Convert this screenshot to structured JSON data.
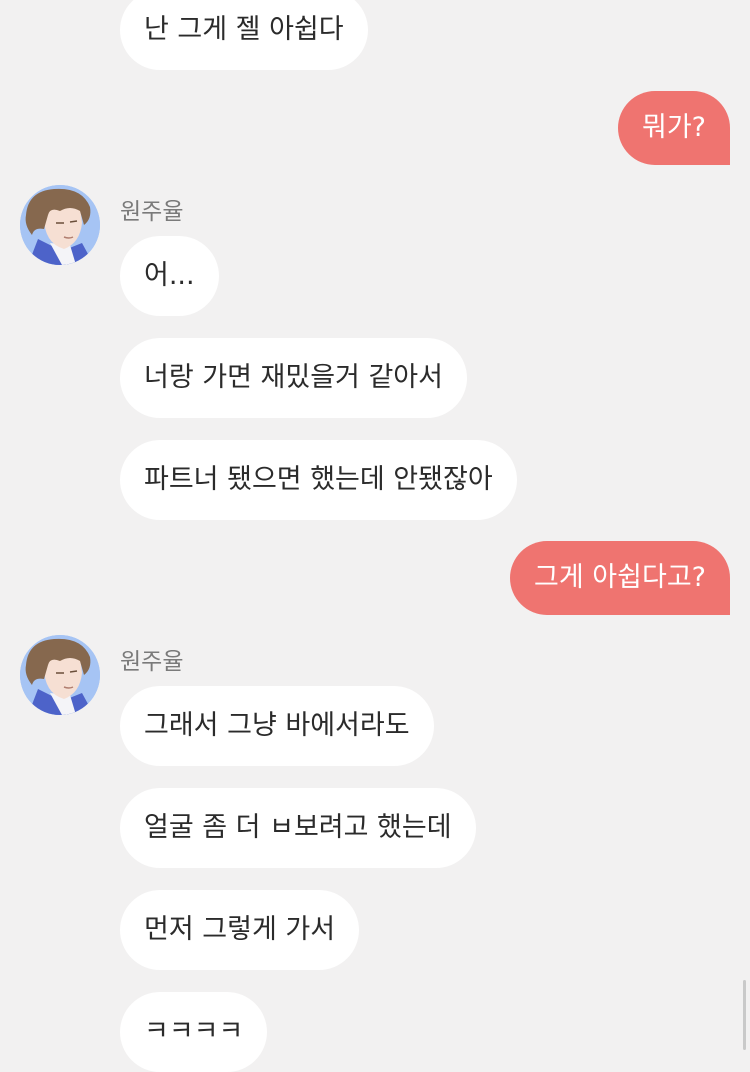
{
  "sender": {
    "name": "원주율"
  },
  "messages": [
    {
      "text": "난 그게 젤 아쉽다"
    },
    {
      "text": "뭐가?"
    },
    {
      "text": "어..."
    },
    {
      "text": "너랑 가면 재밌을거 같아서"
    },
    {
      "text": "파트너 됐으면 했는데 안됐잖아"
    },
    {
      "text": "그게 아쉽다고?"
    },
    {
      "text": "그래서 그냥 바에서라도"
    },
    {
      "text": "얼굴 좀 더 ㅂ보려고 했는데"
    },
    {
      "text": "먼저 그렇게 가서"
    },
    {
      "text": "ㅋㅋㅋㅋ"
    }
  ],
  "colors": {
    "background": "#f2f1f1",
    "received_bubble": "#ffffff",
    "sent_bubble": "#ef7470",
    "sent_text": "#ffffff",
    "received_text": "#2b2b2b",
    "sender_name": "#7a7a7a",
    "avatar_background": "#a6c4f4"
  },
  "icons": {
    "avatar": "profile-avatar-icon"
  }
}
